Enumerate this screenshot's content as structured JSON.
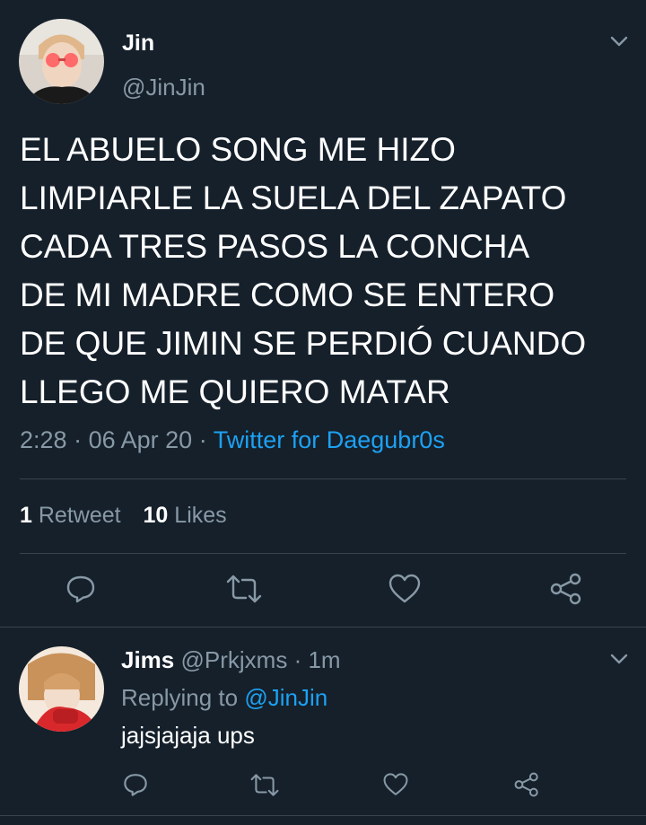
{
  "tweet": {
    "author_name": "Jin",
    "author_handle": "@JinJin",
    "text_lines": [
      "EL ABUELO SONG ME HIZO",
      "LIMPIARLE LA SUELA DEL ZAPATO",
      "CADA TRES PASOS LA CONCHA",
      "DE MI MADRE COMO SE ENTERO",
      "DE QUE JIMIN SE PERDIÓ CUANDO",
      "LLEGO ME QUIERO MATAR"
    ],
    "time": "2:28",
    "date": "06 Apr 20",
    "separator": "·",
    "source": "Twitter for Daegubr0s",
    "retweets_count": "1",
    "retweets_label": "Retweet",
    "likes_count": "10",
    "likes_label": "Likes"
  },
  "reply": {
    "author_name": "Jims",
    "author_handle": "@Prkjxms",
    "separator": "·",
    "time": "1m",
    "replying_prefix": "Replying to",
    "replying_to": "@JinJin",
    "text": "jajsjajaja ups"
  },
  "colors": {
    "background": "#15202b",
    "text": "#ffffff",
    "muted": "#8899a6",
    "accent": "#1da1f2",
    "divider": "#38444d"
  },
  "icons": [
    "chevron-down-icon",
    "reply-icon",
    "retweet-icon",
    "like-icon",
    "share-icon"
  ]
}
